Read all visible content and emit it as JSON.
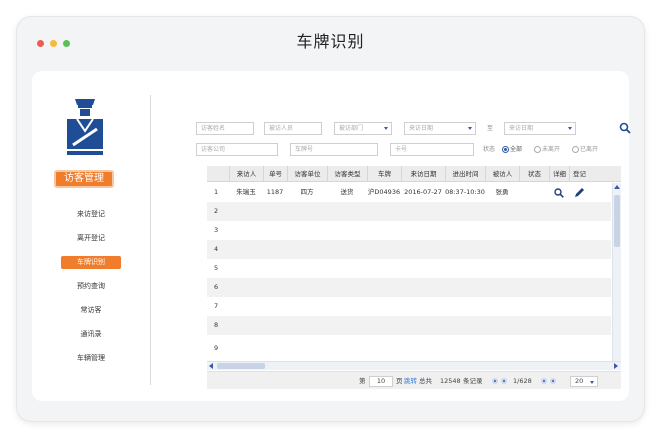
{
  "window": {
    "title": "车牌识别",
    "controls": [
      "close",
      "minimize",
      "maximize"
    ]
  },
  "sidebar": {
    "logo_icon": "security-guard-icon",
    "app_button": "访客管理",
    "items": [
      {
        "label": "来访登记",
        "active": false
      },
      {
        "label": "离开登记",
        "active": false
      },
      {
        "label": "车牌识别",
        "active": true
      },
      {
        "label": "预约查询",
        "active": false
      },
      {
        "label": "常访客",
        "active": false
      },
      {
        "label": "通讯录",
        "active": false
      },
      {
        "label": "车辆管理",
        "active": false
      }
    ]
  },
  "filters": {
    "visitor_name_placeholder": "访客姓名",
    "visited_person_placeholder": "被访人员",
    "visited_dept_placeholder": "被访部门",
    "date_from_placeholder": "来访日期",
    "to_label": "至",
    "date_to_placeholder": "来访日期",
    "visitor_company_placeholder": "访客公司",
    "plate_placeholder": "车牌号",
    "card_placeholder": "卡号",
    "status_label": "状态",
    "status_options": [
      {
        "label": "全部",
        "checked": true
      },
      {
        "label": "未离开",
        "checked": false
      },
      {
        "label": "已离开",
        "checked": false
      }
    ],
    "search_icon": "search-icon"
  },
  "table": {
    "columns": [
      "来访人",
      "单号",
      "访客单位",
      "访客类型",
      "车牌",
      "来访日期",
      "进出时间",
      "被访人",
      "状态",
      "详细",
      "登记"
    ],
    "rows": [
      {
        "n": "1",
        "visitor": "朱瑞玉",
        "no": "1187",
        "company": "四方",
        "type": "送货",
        "plate": "沪D04936",
        "date": "2016-07-27",
        "time": "08:37-10:30",
        "host": "张勇",
        "status": "",
        "detail_icon": "search-icon",
        "edit_icon": "pencil-icon"
      },
      {
        "n": "2"
      },
      {
        "n": "3"
      },
      {
        "n": "4"
      },
      {
        "n": "5"
      },
      {
        "n": "6"
      },
      {
        "n": "7"
      },
      {
        "n": "8"
      },
      {
        "n": "9"
      }
    ]
  },
  "pager": {
    "page_prefix": "第",
    "page_value": "10",
    "page_suffix": "页",
    "jump_label": "跳转",
    "total_prefix": "总共",
    "total_count": "12548",
    "total_suffix": "条记录",
    "page_info": "1/628",
    "page_size": "20"
  },
  "colors": {
    "accent": "#f07d2b",
    "brand_blue": "#3a5aa8"
  }
}
